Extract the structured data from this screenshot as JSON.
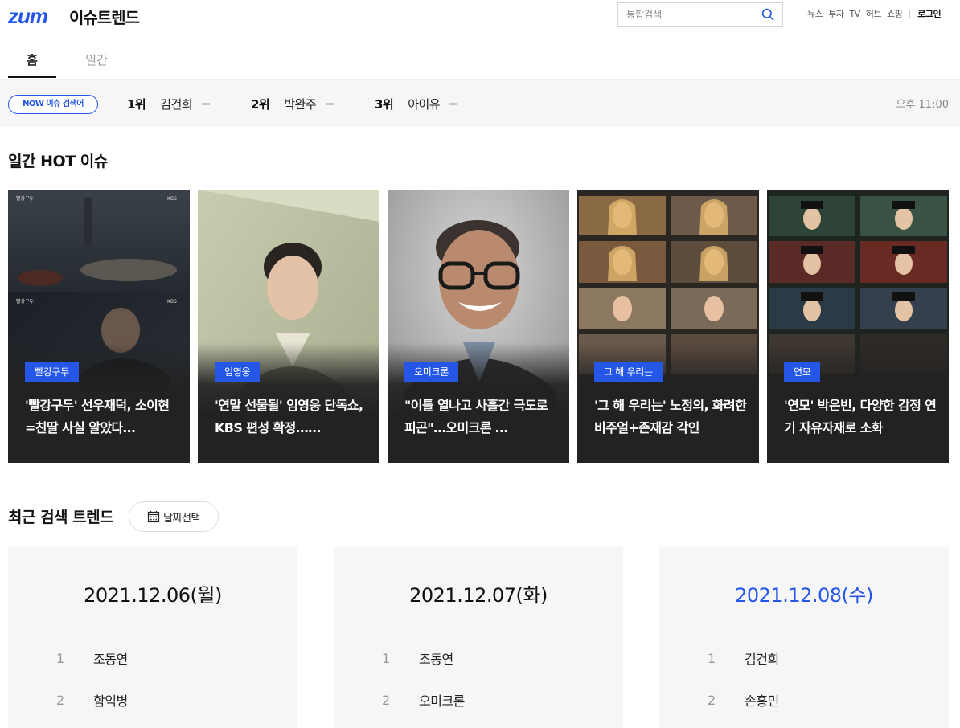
{
  "header": {
    "logo": "zum",
    "service_title": "이슈트렌드",
    "search_placeholder": "통합검색",
    "gnb": [
      "뉴스",
      "투자",
      "TV",
      "허브",
      "쇼핑"
    ],
    "login": "로그인"
  },
  "tabs": [
    {
      "label": "홈",
      "active": true
    },
    {
      "label": "일간",
      "active": false
    }
  ],
  "now_bar": {
    "badge": "NOW 이슈 검색어",
    "ranks": [
      {
        "rank": "1위",
        "keyword": "김건희"
      },
      {
        "rank": "2위",
        "keyword": "박완주"
      },
      {
        "rank": "3위",
        "keyword": "아이유"
      }
    ],
    "time": "오후 11:00"
  },
  "hot": {
    "title": "일간 HOT 이슈",
    "cards": [
      {
        "tag": "빨강구두",
        "headline": "'빨강구두' 선우재덕, 소이현=친딸 사실 알았다…",
        "thumb": "drama-scene"
      },
      {
        "tag": "임영웅",
        "headline": "'연말 선물될' 임영웅 단독쇼, KBS 편성 확정……",
        "thumb": "portrait-singer"
      },
      {
        "tag": "오미크론",
        "headline": "\"이틀 열나고 사흘간 극도로 피곤\"…오미크론 …",
        "thumb": "portrait-doctor"
      },
      {
        "tag": "그 해 우리는",
        "headline": "'그 해 우리는' 노정의, 화려한 비주얼+존재감 각인",
        "thumb": "collage-actress"
      },
      {
        "tag": "연모",
        "headline": "'연모' 박은빈, 다양한 감정 연기 자유자재로 소화",
        "thumb": "collage-historical"
      }
    ]
  },
  "trend": {
    "title": "최근 검색 트렌드",
    "date_button": "날짜선택",
    "columns": [
      {
        "date": "2021.12.06(월)",
        "today": false,
        "items": [
          {
            "n": "1",
            "word": "조동연"
          },
          {
            "n": "2",
            "word": "함익병"
          }
        ]
      },
      {
        "date": "2021.12.07(화)",
        "today": false,
        "items": [
          {
            "n": "1",
            "word": "조동연"
          },
          {
            "n": "2",
            "word": "오미크론"
          }
        ]
      },
      {
        "date": "2021.12.08(수)",
        "today": true,
        "items": [
          {
            "n": "1",
            "word": "김건희"
          },
          {
            "n": "2",
            "word": "손흥민"
          }
        ]
      }
    ]
  },
  "colors": {
    "accent": "#2457e8",
    "card_bg": "#222222",
    "panel_bg": "#f6f6f6"
  }
}
